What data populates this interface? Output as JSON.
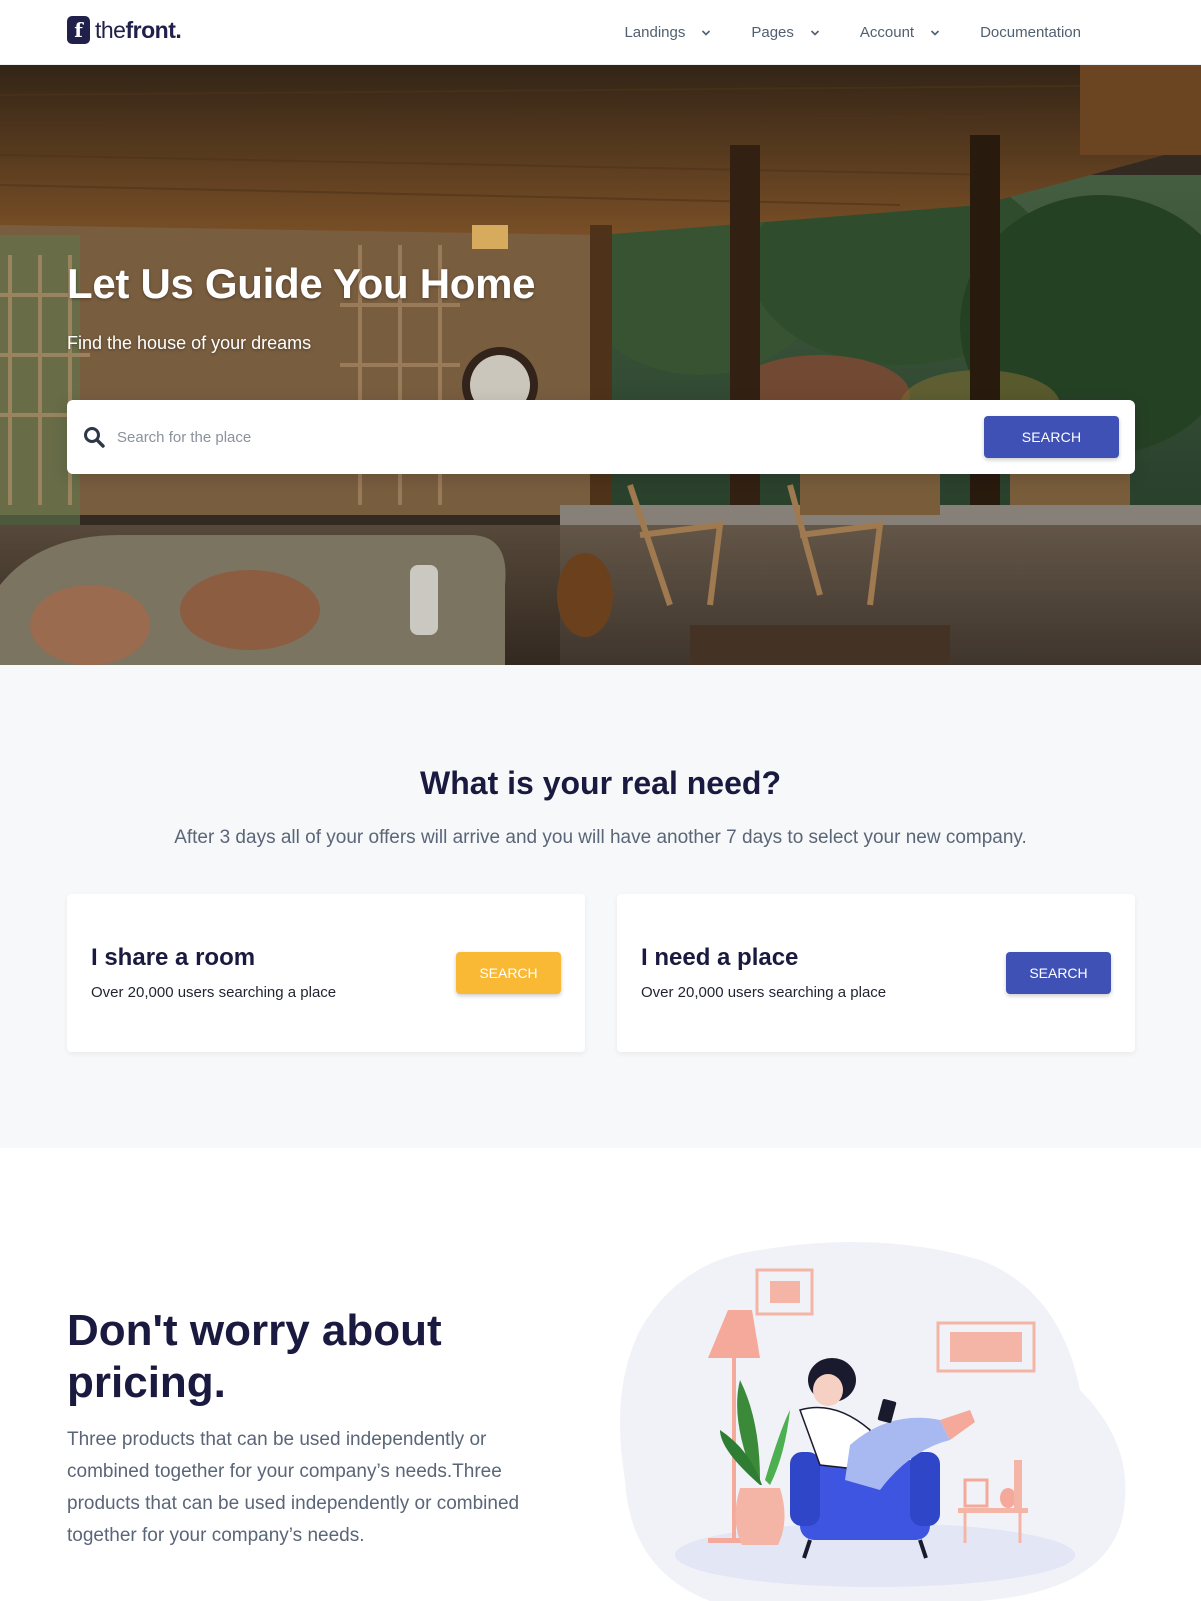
{
  "header": {
    "logo_letter": "f",
    "logo_text_light": "the",
    "logo_text_bold": "front.",
    "nav": [
      {
        "label": "Landings",
        "has_dropdown": true
      },
      {
        "label": "Pages",
        "has_dropdown": true
      },
      {
        "label": "Account",
        "has_dropdown": true
      },
      {
        "label": "Documentation",
        "has_dropdown": false
      }
    ]
  },
  "hero": {
    "title": "Let Us Guide You Home",
    "subtitle": "Find the house of your dreams",
    "search_placeholder": "Search for the place",
    "search_button": "Search",
    "search_icon": "search-icon"
  },
  "needs": {
    "title": "What is your real need?",
    "subtitle": "After 3 days all of your offers will arrive and you will have another 7 days to select your new company.",
    "cards": [
      {
        "title": "I share a room",
        "text": "Over 20,000 users searching a place",
        "button": "Search",
        "button_color": "#f9b934"
      },
      {
        "title": "I need a place",
        "text": "Over 20,000 users searching a place",
        "button": "Search",
        "button_color": "#3f51b5"
      }
    ]
  },
  "pricing": {
    "title": "Don't worry about pricing.",
    "text": "Three products that can be used independently or combined together for your company’s needs.Three products that can be used independently or combined together for your company’s needs."
  },
  "colors": {
    "primary": "#3f51b5",
    "accent": "#f9b934",
    "heading": "#1a1a40",
    "muted": "#5a6678"
  }
}
